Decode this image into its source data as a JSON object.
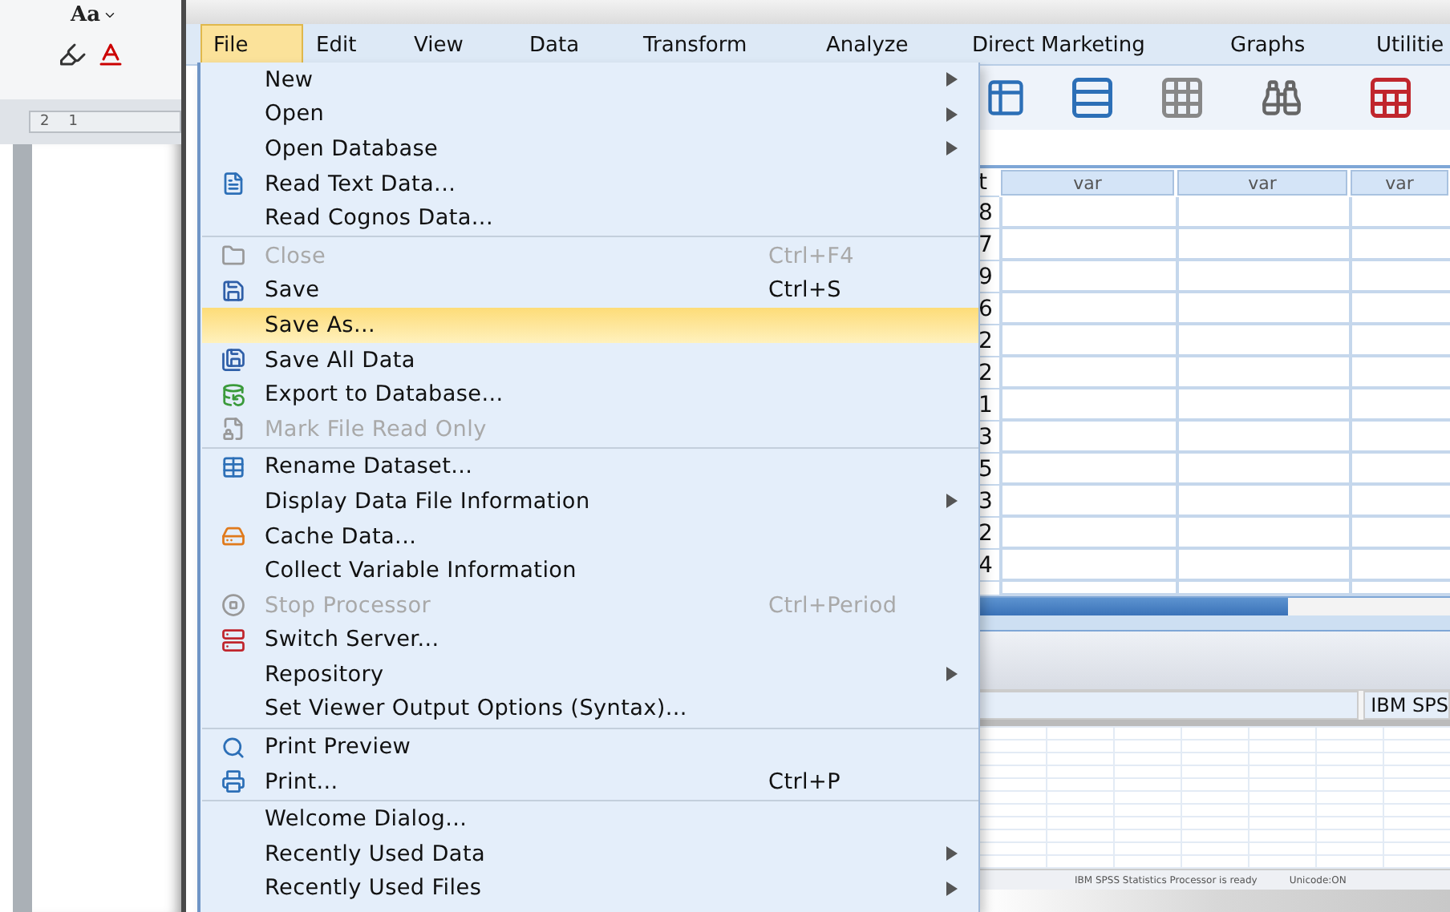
{
  "word": {
    "font_button": "Aa",
    "ruler_labels": [
      "2",
      "1"
    ]
  },
  "menubar": [
    {
      "label": "File",
      "selected": true
    },
    {
      "label": "Edit",
      "selected": false
    },
    {
      "label": "View",
      "selected": false
    },
    {
      "label": "Data",
      "selected": false
    },
    {
      "label": "Transform",
      "selected": false
    },
    {
      "label": "Analyze",
      "selected": false
    },
    {
      "label": "Direct Marketing",
      "selected": false
    },
    {
      "label": "Graphs",
      "selected": false
    },
    {
      "label": "Utilitie",
      "selected": false
    }
  ],
  "file_menu": [
    {
      "kind": "item",
      "label": "New",
      "submenu": true,
      "disabled": false,
      "selected": false
    },
    {
      "kind": "item",
      "label": "Open",
      "submenu": true,
      "disabled": false,
      "selected": false
    },
    {
      "kind": "item",
      "label": "Open Database",
      "submenu": true,
      "disabled": false,
      "selected": false
    },
    {
      "kind": "item",
      "label": "Read Text Data...",
      "submenu": false,
      "disabled": false,
      "selected": false
    },
    {
      "kind": "item",
      "label": "Read Cognos Data...",
      "submenu": false,
      "disabled": false,
      "selected": false
    },
    {
      "kind": "separator"
    },
    {
      "kind": "item",
      "label": "Close",
      "shortcut": "Ctrl+F4",
      "submenu": false,
      "disabled": true,
      "selected": false
    },
    {
      "kind": "item",
      "label": "Save",
      "shortcut": "Ctrl+S",
      "submenu": false,
      "disabled": false,
      "selected": false
    },
    {
      "kind": "item",
      "label": "Save As...",
      "submenu": false,
      "disabled": false,
      "selected": true
    },
    {
      "kind": "item",
      "label": "Save All Data",
      "submenu": false,
      "disabled": false,
      "selected": false
    },
    {
      "kind": "item",
      "label": "Export to Database...",
      "submenu": false,
      "disabled": false,
      "selected": false
    },
    {
      "kind": "item",
      "label": "Mark File Read Only",
      "submenu": false,
      "disabled": true,
      "selected": false
    },
    {
      "kind": "separator"
    },
    {
      "kind": "item",
      "label": "Rename Dataset...",
      "submenu": false,
      "disabled": false,
      "selected": false
    },
    {
      "kind": "item",
      "label": "Display Data File Information",
      "submenu": true,
      "disabled": false,
      "selected": false
    },
    {
      "kind": "item",
      "label": "Cache Data...",
      "submenu": false,
      "disabled": false,
      "selected": false
    },
    {
      "kind": "item",
      "label": "Collect Variable Information",
      "submenu": false,
      "disabled": false,
      "selected": false
    },
    {
      "kind": "item",
      "label": "Stop Processor",
      "shortcut": "Ctrl+Period",
      "submenu": false,
      "disabled": true,
      "selected": false
    },
    {
      "kind": "item",
      "label": "Switch Server...",
      "submenu": false,
      "disabled": false,
      "selected": false
    },
    {
      "kind": "item",
      "label": "Repository",
      "submenu": true,
      "disabled": false,
      "selected": false
    },
    {
      "kind": "item",
      "label": "Set Viewer Output Options (Syntax)...",
      "submenu": false,
      "disabled": false,
      "selected": false
    },
    {
      "kind": "separator"
    },
    {
      "kind": "item",
      "label": "Print Preview",
      "submenu": false,
      "disabled": false,
      "selected": false
    },
    {
      "kind": "item",
      "label": "Print...",
      "shortcut": "Ctrl+P",
      "submenu": false,
      "disabled": false,
      "selected": false
    },
    {
      "kind": "separator"
    },
    {
      "kind": "item",
      "label": "Welcome Dialog...",
      "submenu": false,
      "disabled": false,
      "selected": false
    },
    {
      "kind": "item",
      "label": "Recently Used Data",
      "submenu": true,
      "disabled": false,
      "selected": false
    },
    {
      "kind": "item",
      "label": "Recently Used Files",
      "submenu": true,
      "disabled": false,
      "selected": false
    }
  ],
  "grid": {
    "row_header_label": "t",
    "columns": [
      "var",
      "var",
      "var"
    ],
    "row_values": [
      "8",
      "7",
      "9",
      "6",
      "2",
      "2",
      "1",
      "3",
      "5",
      "3",
      "2",
      "4"
    ]
  },
  "status_bar": {
    "engine": "IBM SPS"
  },
  "background_window": {
    "status": "IBM SPSS Statistics Processor is ready",
    "unicode": "Unicode:ON"
  }
}
